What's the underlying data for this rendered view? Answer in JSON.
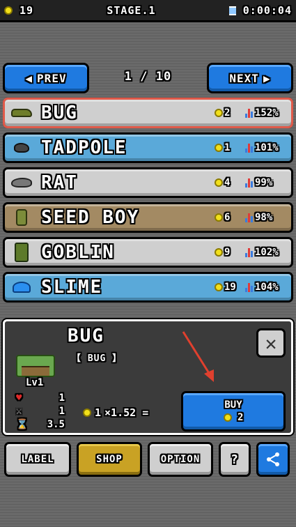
{
  "status": {
    "coins": "19",
    "stage": "STAGE.1",
    "timer": "0:00:04"
  },
  "nav": {
    "prev_label": "PREV",
    "next_label": "NEXT",
    "page": "1 / 10"
  },
  "creatures": [
    {
      "name": "BUG",
      "cost": "2",
      "rate": "152%",
      "theme": "grey",
      "icon": "bug-icon"
    },
    {
      "name": "TADPOLE",
      "cost": "1",
      "rate": "101%",
      "theme": "blue",
      "icon": "tadpole-icon"
    },
    {
      "name": "RAT",
      "cost": "4",
      "rate": "99%",
      "theme": "grey",
      "icon": "rat-icon"
    },
    {
      "name": "SEED BOY",
      "cost": "6",
      "rate": "98%",
      "theme": "tan",
      "icon": "seed-boy-icon"
    },
    {
      "name": "GOBLIN",
      "cost": "9",
      "rate": "102%",
      "theme": "grey",
      "icon": "goblin-icon"
    },
    {
      "name": "SLIME",
      "cost": "19",
      "rate": "104%",
      "theme": "blue",
      "icon": "slime-icon"
    }
  ],
  "detail": {
    "name": "BUG",
    "subtitle": "【 BUG 】",
    "level": "Lv1",
    "hp": "1",
    "attack": "1",
    "time": "3.5",
    "formula_coin": "1",
    "formula_rest": "×1.52 =",
    "buy_label": "BUY",
    "buy_cost": "2"
  },
  "tabs": {
    "label": "LABEL",
    "shop": "SHOP",
    "option": "OPTION",
    "help": "?"
  },
  "colors": {
    "accent_blue": "#1f7ae0",
    "shop_gold": "#c9a224",
    "selection_red": "#e05a4a"
  }
}
